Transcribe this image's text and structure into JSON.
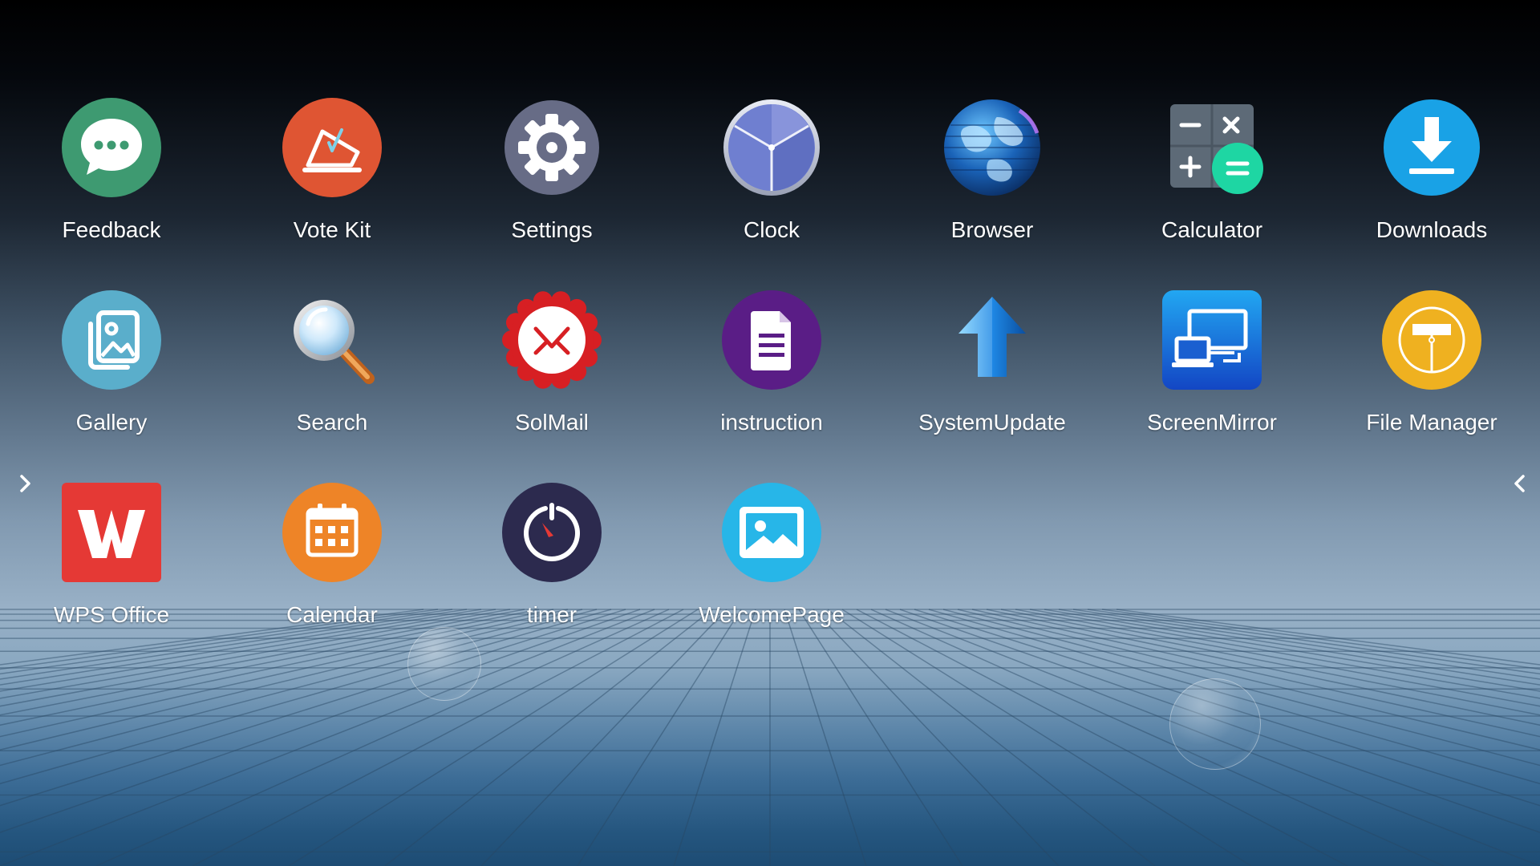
{
  "launcher": {
    "rows": [
      [
        {
          "label": "Feedback",
          "icon": "feedback-chat-icon"
        },
        {
          "label": "Vote Kit",
          "icon": "vote-kit-icon"
        },
        {
          "label": "Settings",
          "icon": "settings-gear-icon"
        },
        {
          "label": "Clock",
          "icon": "clock-icon"
        },
        {
          "label": "Browser",
          "icon": "globe-icon"
        },
        {
          "label": "Calculator",
          "icon": "calculator-icon"
        },
        {
          "label": "Downloads",
          "icon": "download-icon"
        }
      ],
      [
        {
          "label": "Gallery",
          "icon": "gallery-icon"
        },
        {
          "label": "Search",
          "icon": "magnifier-icon"
        },
        {
          "label": "SolMail",
          "icon": "mail-icon"
        },
        {
          "label": "instruction",
          "icon": "document-icon"
        },
        {
          "label": "SystemUpdate",
          "icon": "up-arrow-icon"
        },
        {
          "label": "ScreenMirror",
          "icon": "screen-mirror-icon"
        },
        {
          "label": "File Manager",
          "icon": "file-manager-icon"
        }
      ],
      [
        {
          "label": "WPS Office",
          "icon": "wps-office-icon"
        },
        {
          "label": "Calendar",
          "icon": "calendar-icon"
        },
        {
          "label": "timer",
          "icon": "timer-icon"
        },
        {
          "label": "WelcomePage",
          "icon": "picture-icon"
        }
      ]
    ],
    "nav": {
      "left_icon": "chevron-right-icon",
      "right_icon": "chevron-left-icon"
    },
    "colors": {
      "feedback": "#3e9a71",
      "vote_kit": "#df5533",
      "settings": "#676c86",
      "clock": "#6f7fd0",
      "downloads": "#19a2e6",
      "gallery": "#5aaecb",
      "solmail": "#d71f23",
      "instruction": "#5a1d86",
      "screen_mirror": "#1a5fd0",
      "file_manager": "#efb120",
      "wps_office": "#e53935",
      "calendar": "#ee8427",
      "timer": "#2c2a4e",
      "welcome_page": "#27b6e8"
    }
  }
}
